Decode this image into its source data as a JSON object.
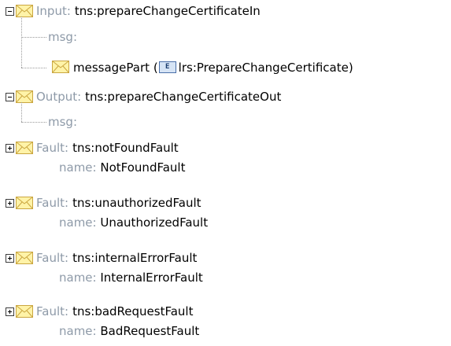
{
  "input": {
    "keyword": "Input:",
    "value": "tns:prepareChangeCertificateIn",
    "msg_label": "msg:",
    "part": {
      "name": "messagePart",
      "open_paren": "(",
      "badge": "E",
      "type": "lrs:PrepareChangeCertificate",
      "close_paren": ")"
    }
  },
  "output": {
    "keyword": "Output:",
    "value": "tns:prepareChangeCertificateOut",
    "msg_label": "msg:"
  },
  "faults": [
    {
      "keyword": "Fault:",
      "value": "tns:notFoundFault",
      "name_label": "name:",
      "name_value": "NotFoundFault"
    },
    {
      "keyword": "Fault:",
      "value": "tns:unauthorizedFault",
      "name_label": "name:",
      "name_value": "UnauthorizedFault"
    },
    {
      "keyword": "Fault:",
      "value": "tns:internalErrorFault",
      "name_label": "name:",
      "name_value": "InternalErrorFault"
    },
    {
      "keyword": "Fault:",
      "value": "tns:badRequestFault",
      "name_label": "name:",
      "name_value": "BadRequestFault"
    }
  ],
  "icons": {
    "collapse": "minus-box-icon",
    "expand": "plus-box-icon",
    "message": "envelope-icon",
    "element": "element-badge-icon"
  },
  "colors": {
    "keyword": "#8e9aa8",
    "text": "#000000",
    "envelope_fill": "#fff3a8",
    "envelope_stroke": "#caa640",
    "badge_fill": "#d6e4f5",
    "badge_stroke": "#4a6fa8"
  }
}
